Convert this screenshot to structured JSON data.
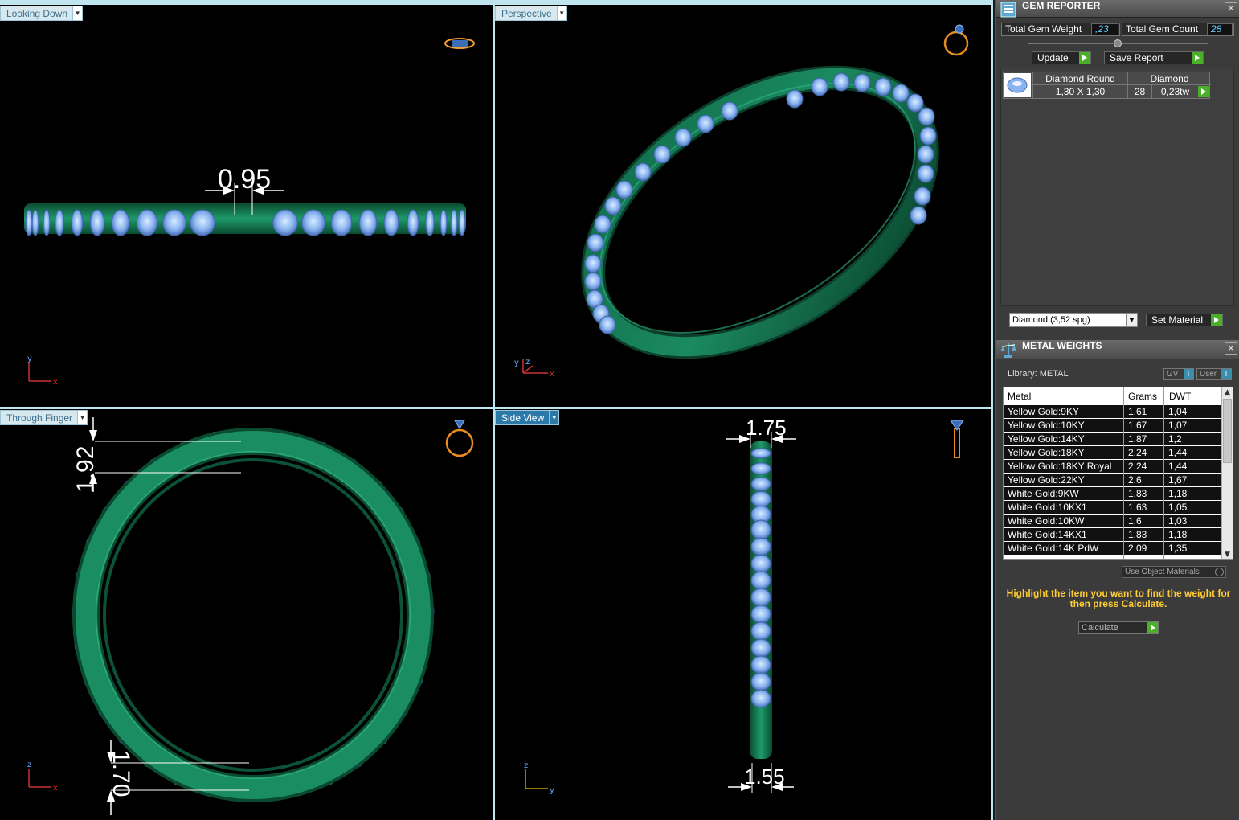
{
  "viewports": {
    "top_left": {
      "label": "Looking Down",
      "dimension": "0.95",
      "axes": [
        "y",
        "x"
      ]
    },
    "top_right": {
      "label": "Perspective",
      "axes": [
        "y",
        "z",
        "x"
      ]
    },
    "bottom_left": {
      "label": "Through Finger",
      "dimension_top": "1.92",
      "dimension_bottom": "1.70",
      "axes": [
        "z",
        "x"
      ]
    },
    "bottom_right": {
      "label": "Side View",
      "dimension_top": "1.75",
      "dimension_bottom": "1.55",
      "axes": [
        "z",
        "y"
      ]
    }
  },
  "gem_reporter": {
    "title": "GEM REPORTER",
    "total_weight_label": "Total Gem Weight",
    "total_weight": ",23",
    "total_count_label": "Total Gem Count",
    "total_count": "28",
    "update_label": "Update",
    "save_label": "Save Report",
    "gem": {
      "name": "Diamond Round",
      "type": "Diamond",
      "size": "1,30 X 1,30",
      "count": "28",
      "weight": "0,23tw"
    },
    "material_select": "Diamond    (3,52 spg)",
    "set_material_label": "Set Material"
  },
  "metal_weights": {
    "title": "METAL WEIGHTS",
    "library": "Library: METAL",
    "gv_label": "GV",
    "user_label": "User",
    "columns": [
      "Metal",
      "Grams",
      "DWT"
    ],
    "rows": [
      [
        "Yellow Gold:9KY",
        "1.61",
        "1,04"
      ],
      [
        "Yellow Gold:10KY",
        "1.67",
        "1,07"
      ],
      [
        "Yellow Gold:14KY",
        "1.87",
        "1,2"
      ],
      [
        "Yellow Gold:18KY",
        "2.24",
        "1,44"
      ],
      [
        "Yellow Gold:18KY Royal",
        "2.24",
        "1,44"
      ],
      [
        "Yellow Gold:22KY",
        "2.6",
        "1,67"
      ],
      [
        "White Gold:9KW",
        "1.83",
        "1,18"
      ],
      [
        "White Gold:10KX1",
        "1.63",
        "1,05"
      ],
      [
        "White Gold:10KW",
        "1.6",
        "1,03"
      ],
      [
        "White Gold:14KX1",
        "1.83",
        "1,18"
      ],
      [
        "White Gold:14K PdW",
        "2.09",
        "1,35"
      ]
    ],
    "use_object_label": "Use Object Materials",
    "hint": "Highlight the item you want to find the weight for then press Calculate.",
    "calculate_label": "Calculate"
  }
}
